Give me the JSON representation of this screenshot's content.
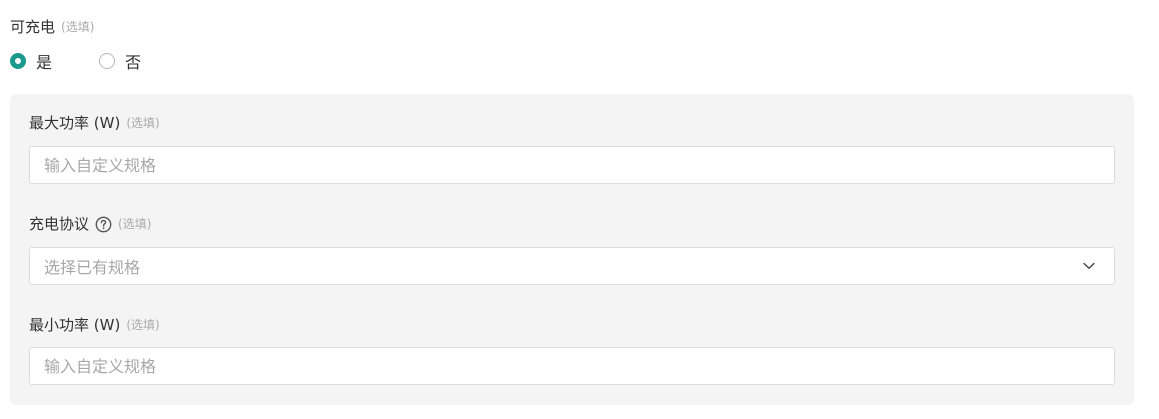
{
  "charging": {
    "label": "可充电",
    "optional": "(选填)",
    "options": [
      {
        "label": "是",
        "checked": true
      },
      {
        "label": "否",
        "checked": false
      }
    ]
  },
  "max_power": {
    "label": "最大功率 (W)",
    "optional": "(选填)",
    "placeholder": "输入自定义规格"
  },
  "protocol": {
    "label": "充电协议",
    "optional": "(选填)",
    "placeholder": "选择已有规格",
    "help_icon": "question-circle-icon",
    "dropdown_icon": "chevron-down-icon"
  },
  "min_power": {
    "label": "最小功率 (W)",
    "optional": "(选填)",
    "placeholder": "输入自定义规格"
  },
  "colors": {
    "accent": "#1a9a8c",
    "panel_bg": "#f4f4f4",
    "placeholder": "#a8a8a8"
  }
}
